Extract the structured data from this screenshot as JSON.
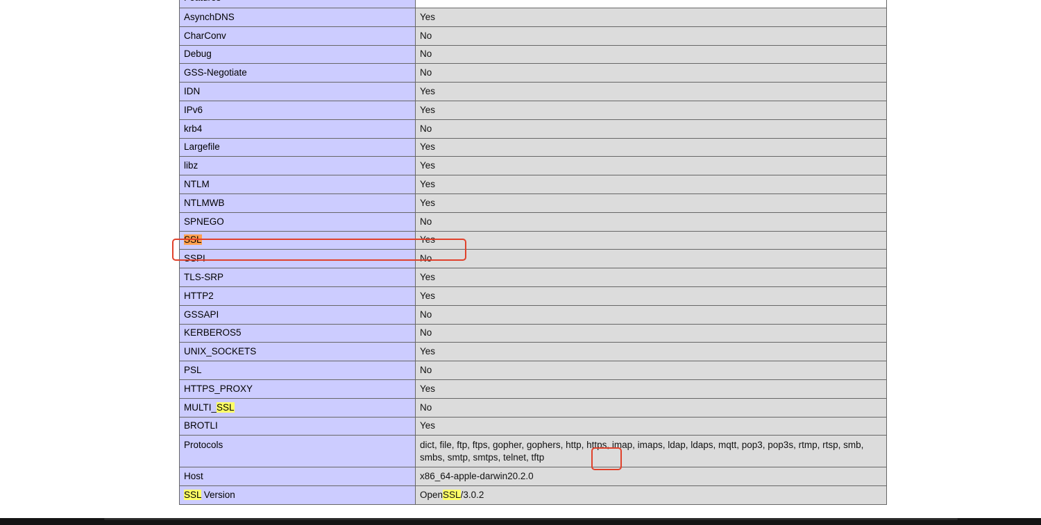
{
  "table": {
    "header_key": "Features",
    "rows": [
      {
        "key": "AsynchDNS",
        "value": "Yes"
      },
      {
        "key": "CharConv",
        "value": "No"
      },
      {
        "key": "Debug",
        "value": "No"
      },
      {
        "key": "GSS-Negotiate",
        "value": "No"
      },
      {
        "key": "IDN",
        "value": "Yes"
      },
      {
        "key": "IPv6",
        "value": "Yes"
      },
      {
        "key": "krb4",
        "value": "No"
      },
      {
        "key": "Largefile",
        "value": "Yes"
      },
      {
        "key": "libz",
        "value": "Yes"
      },
      {
        "key": "NTLM",
        "value": "Yes"
      },
      {
        "key": "NTLMWB",
        "value": "Yes"
      },
      {
        "key": "SPNEGO",
        "value": "No"
      },
      {
        "key": "SSL",
        "value": "Yes"
      },
      {
        "key": "SSPI",
        "value": "No"
      },
      {
        "key": "TLS-SRP",
        "value": "Yes"
      },
      {
        "key": "HTTP2",
        "value": "Yes"
      },
      {
        "key": "GSSAPI",
        "value": "No"
      },
      {
        "key": "KERBEROS5",
        "value": "No"
      },
      {
        "key": "UNIX_SOCKETS",
        "value": "Yes"
      },
      {
        "key": "PSL",
        "value": "No"
      },
      {
        "key": "HTTPS_PROXY",
        "value": "Yes"
      },
      {
        "key_prefix": "MULTI_",
        "key_highlight": "SSL",
        "value": "No"
      },
      {
        "key": "BROTLI",
        "value": "Yes"
      }
    ],
    "protocols": {
      "key": "Protocols",
      "value_before": "dict, file, ftp, ftps, gopher, gophers, http, ",
      "value_boxed": "https,",
      "value_after": " imap, imaps, ldap, ldaps, mqtt, pop3, pop3s, rtmp, rtsp, smb, smbs, smtp, smtps, telnet, tftp"
    },
    "host": {
      "key": "Host",
      "value": "x86_64-apple-darwin20.2.0"
    },
    "ssl_version": {
      "key_highlight": "SSL",
      "key_rest": " Version",
      "value_prefix": "Open",
      "value_highlight": "SSL",
      "value_rest": "/3.0.2"
    }
  },
  "colors": {
    "key_cell_bg": "#ccccff",
    "value_cell_bg": "#dcdcdc",
    "search_highlight": "#ffff66",
    "active_search_highlight": "#ffa04f",
    "annotation_border": "#e0412b"
  }
}
